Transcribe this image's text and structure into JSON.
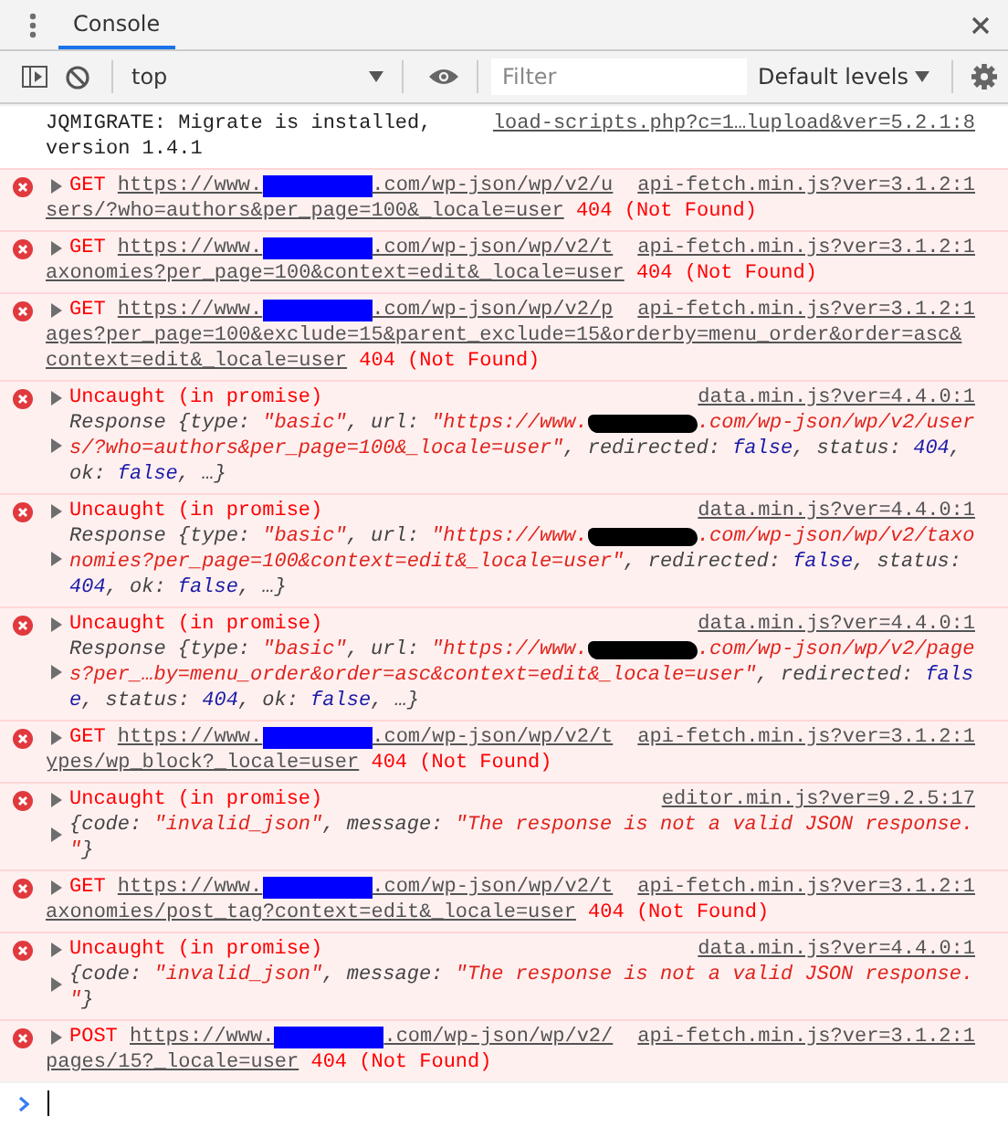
{
  "drawer": {
    "tabs": [
      {
        "label": "Console",
        "selected": true
      }
    ]
  },
  "toolbar": {
    "context": "top",
    "filter": {
      "placeholder": "Filter"
    },
    "levels": "Default levels"
  },
  "messages": [
    {
      "kind": "info",
      "lines": [
        "JQMIGRATE: Migrate is installed,",
        "version 1.4.1"
      ],
      "source": "load-scripts.php?c=1…lupload&ver=5.2.1:8"
    },
    {
      "kind": "network",
      "method": "GET",
      "url_lines": [
        [
          {
            "kind": "text",
            "text": "https://www."
          },
          {
            "kind": "redaction",
            "color": "#0000ff"
          },
          {
            "kind": "text",
            "text": ".com/wp-json/wp/v2/u"
          }
        ],
        [
          {
            "kind": "text",
            "text": "sers/?who=authors&per_page=100&_locale=user"
          }
        ]
      ],
      "status": "404 (Not Found)",
      "source": "api-fetch.min.js?ver=3.1.2:1"
    },
    {
      "kind": "network",
      "method": "GET",
      "url_lines": [
        [
          {
            "kind": "text",
            "text": "https://www."
          },
          {
            "kind": "redaction",
            "color": "#0000ff"
          },
          {
            "kind": "text",
            "text": ".com/wp-json/wp/v2/t"
          }
        ],
        [
          {
            "kind": "text",
            "text": "axonomies?per_page=100&context=edit&_locale=user"
          }
        ]
      ],
      "status": "404 (Not Found)",
      "source": "api-fetch.min.js?ver=3.1.2:1"
    },
    {
      "kind": "network",
      "method": "GET",
      "url_lines": [
        [
          {
            "kind": "text",
            "text": "https://www."
          },
          {
            "kind": "redaction",
            "color": "#0000ff"
          },
          {
            "kind": "text",
            "text": ".com/wp-json/wp/v2/p"
          }
        ],
        [
          {
            "kind": "text",
            "text": "ages?per_page=100&exclude=15&parent_exclude=15&orderby=menu_order&order=asc&"
          }
        ],
        [
          {
            "kind": "text",
            "text": "context=edit&_locale=user"
          }
        ]
      ],
      "status": "404 (Not Found)",
      "source": "api-fetch.min.js?ver=3.1.2:1"
    },
    {
      "kind": "promise",
      "title": "Uncaught (in promise)",
      "source": "data.min.js?ver=4.4.0:1",
      "body": [
        [
          {
            "kind": "text",
            "text": "Response {type: "
          },
          {
            "kind": "string",
            "text": "\"basic\""
          },
          {
            "kind": "text",
            "text": ", url: "
          },
          {
            "kind": "string",
            "text": "\"https://www."
          },
          {
            "kind": "redaction",
            "color": "#000000"
          },
          {
            "kind": "string",
            "text": ".com/wp-json/wp/v2/user"
          }
        ],
        [
          {
            "kind": "string",
            "text": "s/?who=authors&per_page=100&_locale=user\""
          },
          {
            "kind": "text",
            "text": ", redirected: "
          },
          {
            "kind": "literal",
            "text": "false"
          },
          {
            "kind": "text",
            "text": ", status: "
          },
          {
            "kind": "literal",
            "text": "404"
          },
          {
            "kind": "text",
            "text": ","
          }
        ],
        [
          {
            "kind": "text",
            "text": "ok: "
          },
          {
            "kind": "literal",
            "text": "false"
          },
          {
            "kind": "text",
            "text": ", …}"
          }
        ]
      ]
    },
    {
      "kind": "promise",
      "title": "Uncaught (in promise)",
      "source": "data.min.js?ver=4.4.0:1",
      "body": [
        [
          {
            "kind": "text",
            "text": "Response {type: "
          },
          {
            "kind": "string",
            "text": "\"basic\""
          },
          {
            "kind": "text",
            "text": ", url: "
          },
          {
            "kind": "string",
            "text": "\"https://www."
          },
          {
            "kind": "redaction",
            "color": "#000000"
          },
          {
            "kind": "string",
            "text": ".com/wp-json/wp/v2/taxo"
          }
        ],
        [
          {
            "kind": "string",
            "text": "nomies?per_page=100&context=edit&_locale=user\""
          },
          {
            "kind": "text",
            "text": ", redirected: "
          },
          {
            "kind": "literal",
            "text": "false"
          },
          {
            "kind": "text",
            "text": ", status:"
          }
        ],
        [
          {
            "kind": "literal",
            "text": "404"
          },
          {
            "kind": "text",
            "text": ", ok: "
          },
          {
            "kind": "literal",
            "text": "false"
          },
          {
            "kind": "text",
            "text": ", …}"
          }
        ]
      ]
    },
    {
      "kind": "promise",
      "title": "Uncaught (in promise)",
      "source": "data.min.js?ver=4.4.0:1",
      "body": [
        [
          {
            "kind": "text",
            "text": "Response {type: "
          },
          {
            "kind": "string",
            "text": "\"basic\""
          },
          {
            "kind": "text",
            "text": ", url: "
          },
          {
            "kind": "string",
            "text": "\"https://www."
          },
          {
            "kind": "redaction",
            "color": "#000000"
          },
          {
            "kind": "string",
            "text": ".com/wp-json/wp/v2/page"
          }
        ],
        [
          {
            "kind": "string",
            "text": "s?per_…by=menu_order&order=asc&context=edit&_locale=user\""
          },
          {
            "kind": "text",
            "text": ", redirected: "
          },
          {
            "kind": "literal",
            "text": "fals"
          }
        ],
        [
          {
            "kind": "literal",
            "text": "e"
          },
          {
            "kind": "text",
            "text": ", status: "
          },
          {
            "kind": "literal",
            "text": "404"
          },
          {
            "kind": "text",
            "text": ", ok: "
          },
          {
            "kind": "literal",
            "text": "false"
          },
          {
            "kind": "text",
            "text": ", …}"
          }
        ]
      ]
    },
    {
      "kind": "network",
      "method": "GET",
      "url_lines": [
        [
          {
            "kind": "text",
            "text": "https://www."
          },
          {
            "kind": "redaction",
            "color": "#0000ff"
          },
          {
            "kind": "text",
            "text": ".com/wp-json/wp/v2/t"
          }
        ],
        [
          {
            "kind": "text",
            "text": "ypes/wp_block?_locale=user"
          }
        ]
      ],
      "status": "404 (Not Found)",
      "source": "api-fetch.min.js?ver=3.1.2:1"
    },
    {
      "kind": "promise",
      "title": "Uncaught (in promise)",
      "source": "editor.min.js?ver=9.2.5:17",
      "body": [
        [
          {
            "kind": "text",
            "text": "{code: "
          },
          {
            "kind": "string",
            "text": "\"invalid_json\""
          },
          {
            "kind": "text",
            "text": ", message: "
          },
          {
            "kind": "string",
            "text": "\"The response is not a valid JSON response."
          }
        ],
        [
          {
            "kind": "string",
            "text": "\""
          },
          {
            "kind": "text",
            "text": "}"
          }
        ]
      ]
    },
    {
      "kind": "network",
      "method": "GET",
      "url_lines": [
        [
          {
            "kind": "text",
            "text": "https://www."
          },
          {
            "kind": "redaction",
            "color": "#0000ff"
          },
          {
            "kind": "text",
            "text": ".com/wp-json/wp/v2/t"
          }
        ],
        [
          {
            "kind": "text",
            "text": "axonomies/post_tag?context=edit&_locale=user"
          }
        ]
      ],
      "status": "404 (Not Found)",
      "source": "api-fetch.min.js?ver=3.1.2:1"
    },
    {
      "kind": "promise",
      "title": "Uncaught (in promise)",
      "source": "data.min.js?ver=4.4.0:1",
      "body": [
        [
          {
            "kind": "text",
            "text": "{code: "
          },
          {
            "kind": "string",
            "text": "\"invalid_json\""
          },
          {
            "kind": "text",
            "text": ", message: "
          },
          {
            "kind": "string",
            "text": "\"The response is not a valid JSON response."
          }
        ],
        [
          {
            "kind": "string",
            "text": "\""
          },
          {
            "kind": "text",
            "text": "}"
          }
        ]
      ]
    },
    {
      "kind": "network",
      "method": "POST",
      "url_lines": [
        [
          {
            "kind": "text",
            "text": "https://www."
          },
          {
            "kind": "redaction",
            "color": "#0000ff"
          },
          {
            "kind": "text",
            "text": ".com/wp-json/wp/v2/"
          }
        ],
        [
          {
            "kind": "text",
            "text": "pages/15?_locale=user"
          }
        ]
      ],
      "status": "404 (Not Found)",
      "source": "api-fetch.min.js?ver=3.1.2:1"
    }
  ]
}
